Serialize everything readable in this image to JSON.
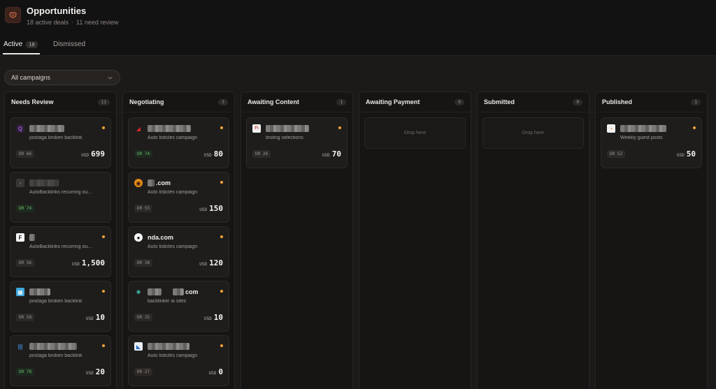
{
  "header": {
    "title": "Opportunities",
    "active_deals": "18 active deals",
    "need_review": "11 need review",
    "separator": "·"
  },
  "tabs": [
    {
      "label": "Active",
      "count": "18"
    },
    {
      "label": "Dismissed"
    }
  ],
  "filter": {
    "selected": "All campaigns"
  },
  "columns": [
    {
      "title": "Needs Review",
      "count": "11"
    },
    {
      "title": "Negotiating",
      "count": "5"
    },
    {
      "title": "Awaiting Content",
      "count": "1"
    },
    {
      "title": "Awaiting Payment",
      "count": "0",
      "placeholder": "Drop here"
    },
    {
      "title": "Submitted",
      "count": "0",
      "placeholder": "Drop here"
    },
    {
      "title": "Published",
      "count": "1"
    }
  ],
  "cards": {
    "needs_review": [
      {
        "campaign": "postaga broken backlink",
        "dr": "DR 66",
        "currency": "USD",
        "amount": "699"
      },
      {
        "campaign": "AutoBacklinks recurring ou...",
        "dr": "DR 74"
      },
      {
        "campaign": "AutoBacklinks recurring ou...",
        "dr": "DR 56",
        "currency": "USD",
        "amount": "1,500"
      },
      {
        "campaign": "postaga broken backlink",
        "dr": "DR 58",
        "currency": "USD",
        "amount": "10"
      },
      {
        "campaign": "postaga broken backlink",
        "dr": "DR 78",
        "currency": "USD",
        "amount": "20"
      }
    ],
    "negotiating": [
      {
        "campaign": "Auto listicles campaign",
        "dr": "DR 74",
        "currency": "USD",
        "amount": "80"
      },
      {
        "name_suffix": ".com",
        "campaign": "Auto listicles campaign",
        "dr": "DR 55",
        "currency": "USD",
        "amount": "150"
      },
      {
        "name_suffix": "nda.com",
        "campaign": "Auto listicles campaign",
        "dr": "DR 38",
        "currency": "USD",
        "amount": "120"
      },
      {
        "name_suffix": "com",
        "campaign": "backlinker ai sites",
        "dr": "DR 25",
        "currency": "USD",
        "amount": "10"
      },
      {
        "campaign": "Auto listicles campaign",
        "dr": "DR 27",
        "currency": "USD",
        "amount": "0"
      }
    ],
    "awaiting_content": [
      {
        "campaign": "testing selections",
        "dr": "DR 26",
        "currency": "USD",
        "amount": "70"
      }
    ],
    "published": [
      {
        "campaign": "Weekly guest posts",
        "dr": "DR 52",
        "currency": "USD",
        "amount": "50"
      }
    ]
  },
  "colors": {
    "accent_dot": "#f0a33a",
    "good_dr": "#6dbb6f",
    "background": "#1c1a19"
  }
}
